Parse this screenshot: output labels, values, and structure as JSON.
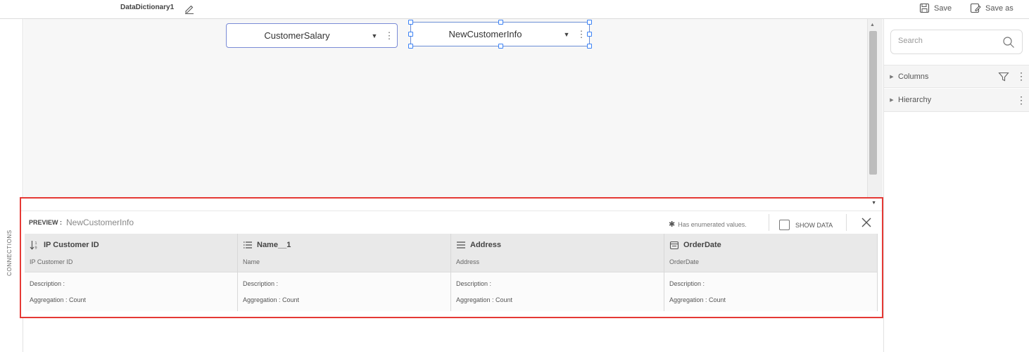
{
  "top_bar": {
    "document_title": "DataDictionary1",
    "save_label": "Save",
    "save_as_label": "Save as"
  },
  "left_strip": {
    "connections_label": "CONNECTIONS"
  },
  "canvas": {
    "nodes": [
      {
        "label": "CustomerSalary"
      },
      {
        "label": "NewCustomerInfo"
      }
    ]
  },
  "right_panel": {
    "search_placeholder": "Search",
    "sections": [
      {
        "label": "Columns"
      },
      {
        "label": "Hierarchy"
      }
    ]
  },
  "preview": {
    "label": "PREVIEW :",
    "table_name": "NewCustomerInfo",
    "enum_note": "Has enumerated values.",
    "show_data_label": "SHOW DATA",
    "columns": [
      {
        "name": "IP Customer ID",
        "subtitle": "IP Customer ID",
        "description": "Description :",
        "aggregation": "Aggregation : Count",
        "icon": "sort-numeric-icon"
      },
      {
        "name": "Name__1",
        "subtitle": "Name",
        "description": "Description :",
        "aggregation": "Aggregation : Count",
        "icon": "list-icon"
      },
      {
        "name": "Address",
        "subtitle": "Address",
        "description": "Description :",
        "aggregation": "Aggregation : Count",
        "icon": "list-icon"
      },
      {
        "name": "OrderDate",
        "subtitle": "OrderDate",
        "description": "Description :",
        "aggregation": "Aggregation : Count",
        "icon": "calendar-icon"
      }
    ]
  },
  "colors": {
    "selection_outline": "#e53935",
    "node_border": "#7a8bd6",
    "handle": "#3b82f6"
  }
}
